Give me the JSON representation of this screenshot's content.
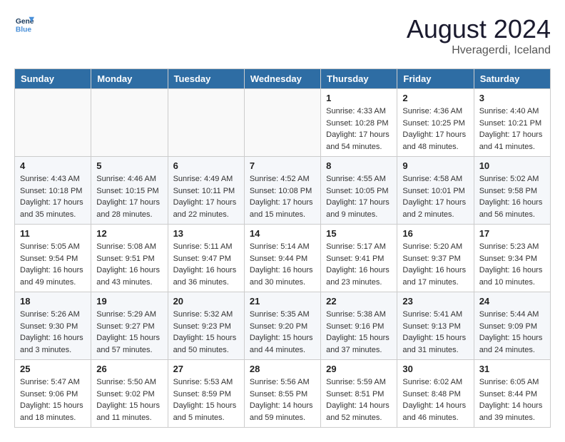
{
  "logo": {
    "line1": "General",
    "line2": "Blue"
  },
  "title": "August 2024",
  "subtitle": "Hveragerdi, Iceland",
  "days_of_week": [
    "Sunday",
    "Monday",
    "Tuesday",
    "Wednesday",
    "Thursday",
    "Friday",
    "Saturday"
  ],
  "weeks": [
    [
      {
        "num": "",
        "info": ""
      },
      {
        "num": "",
        "info": ""
      },
      {
        "num": "",
        "info": ""
      },
      {
        "num": "",
        "info": ""
      },
      {
        "num": "1",
        "info": "Sunrise: 4:33 AM\nSunset: 10:28 PM\nDaylight: 17 hours\nand 54 minutes."
      },
      {
        "num": "2",
        "info": "Sunrise: 4:36 AM\nSunset: 10:25 PM\nDaylight: 17 hours\nand 48 minutes."
      },
      {
        "num": "3",
        "info": "Sunrise: 4:40 AM\nSunset: 10:21 PM\nDaylight: 17 hours\nand 41 minutes."
      }
    ],
    [
      {
        "num": "4",
        "info": "Sunrise: 4:43 AM\nSunset: 10:18 PM\nDaylight: 17 hours\nand 35 minutes."
      },
      {
        "num": "5",
        "info": "Sunrise: 4:46 AM\nSunset: 10:15 PM\nDaylight: 17 hours\nand 28 minutes."
      },
      {
        "num": "6",
        "info": "Sunrise: 4:49 AM\nSunset: 10:11 PM\nDaylight: 17 hours\nand 22 minutes."
      },
      {
        "num": "7",
        "info": "Sunrise: 4:52 AM\nSunset: 10:08 PM\nDaylight: 17 hours\nand 15 minutes."
      },
      {
        "num": "8",
        "info": "Sunrise: 4:55 AM\nSunset: 10:05 PM\nDaylight: 17 hours\nand 9 minutes."
      },
      {
        "num": "9",
        "info": "Sunrise: 4:58 AM\nSunset: 10:01 PM\nDaylight: 17 hours\nand 2 minutes."
      },
      {
        "num": "10",
        "info": "Sunrise: 5:02 AM\nSunset: 9:58 PM\nDaylight: 16 hours\nand 56 minutes."
      }
    ],
    [
      {
        "num": "11",
        "info": "Sunrise: 5:05 AM\nSunset: 9:54 PM\nDaylight: 16 hours\nand 49 minutes."
      },
      {
        "num": "12",
        "info": "Sunrise: 5:08 AM\nSunset: 9:51 PM\nDaylight: 16 hours\nand 43 minutes."
      },
      {
        "num": "13",
        "info": "Sunrise: 5:11 AM\nSunset: 9:47 PM\nDaylight: 16 hours\nand 36 minutes."
      },
      {
        "num": "14",
        "info": "Sunrise: 5:14 AM\nSunset: 9:44 PM\nDaylight: 16 hours\nand 30 minutes."
      },
      {
        "num": "15",
        "info": "Sunrise: 5:17 AM\nSunset: 9:41 PM\nDaylight: 16 hours\nand 23 minutes."
      },
      {
        "num": "16",
        "info": "Sunrise: 5:20 AM\nSunset: 9:37 PM\nDaylight: 16 hours\nand 17 minutes."
      },
      {
        "num": "17",
        "info": "Sunrise: 5:23 AM\nSunset: 9:34 PM\nDaylight: 16 hours\nand 10 minutes."
      }
    ],
    [
      {
        "num": "18",
        "info": "Sunrise: 5:26 AM\nSunset: 9:30 PM\nDaylight: 16 hours\nand 3 minutes."
      },
      {
        "num": "19",
        "info": "Sunrise: 5:29 AM\nSunset: 9:27 PM\nDaylight: 15 hours\nand 57 minutes."
      },
      {
        "num": "20",
        "info": "Sunrise: 5:32 AM\nSunset: 9:23 PM\nDaylight: 15 hours\nand 50 minutes."
      },
      {
        "num": "21",
        "info": "Sunrise: 5:35 AM\nSunset: 9:20 PM\nDaylight: 15 hours\nand 44 minutes."
      },
      {
        "num": "22",
        "info": "Sunrise: 5:38 AM\nSunset: 9:16 PM\nDaylight: 15 hours\nand 37 minutes."
      },
      {
        "num": "23",
        "info": "Sunrise: 5:41 AM\nSunset: 9:13 PM\nDaylight: 15 hours\nand 31 minutes."
      },
      {
        "num": "24",
        "info": "Sunrise: 5:44 AM\nSunset: 9:09 PM\nDaylight: 15 hours\nand 24 minutes."
      }
    ],
    [
      {
        "num": "25",
        "info": "Sunrise: 5:47 AM\nSunset: 9:06 PM\nDaylight: 15 hours\nand 18 minutes."
      },
      {
        "num": "26",
        "info": "Sunrise: 5:50 AM\nSunset: 9:02 PM\nDaylight: 15 hours\nand 11 minutes."
      },
      {
        "num": "27",
        "info": "Sunrise: 5:53 AM\nSunset: 8:59 PM\nDaylight: 15 hours\nand 5 minutes."
      },
      {
        "num": "28",
        "info": "Sunrise: 5:56 AM\nSunset: 8:55 PM\nDaylight: 14 hours\nand 59 minutes."
      },
      {
        "num": "29",
        "info": "Sunrise: 5:59 AM\nSunset: 8:51 PM\nDaylight: 14 hours\nand 52 minutes."
      },
      {
        "num": "30",
        "info": "Sunrise: 6:02 AM\nSunset: 8:48 PM\nDaylight: 14 hours\nand 46 minutes."
      },
      {
        "num": "31",
        "info": "Sunrise: 6:05 AM\nSunset: 8:44 PM\nDaylight: 14 hours\nand 39 minutes."
      }
    ]
  ]
}
